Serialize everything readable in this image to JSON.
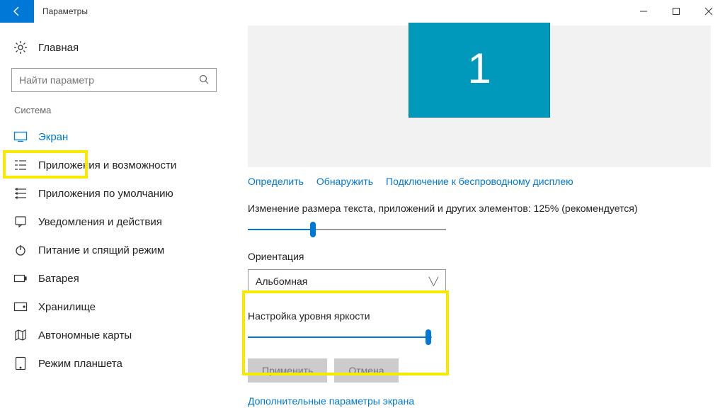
{
  "titlebar": {
    "title": "Параметры"
  },
  "sidebar": {
    "home": "Главная",
    "search_placeholder": "Найти параметр",
    "section": "Система",
    "items": [
      {
        "label": "Экран"
      },
      {
        "label": "Приложения и возможности"
      },
      {
        "label": "Приложения по умолчанию"
      },
      {
        "label": "Уведомления и действия"
      },
      {
        "label": "Питание и спящий режим"
      },
      {
        "label": "Батарея"
      },
      {
        "label": "Хранилище"
      },
      {
        "label": "Автономные карты"
      },
      {
        "label": "Режим планшета"
      }
    ]
  },
  "main": {
    "monitor_number": "1",
    "links": {
      "identify": "Определить",
      "detect": "Обнаружить",
      "wireless": "Подключение к беспроводному дисплею"
    },
    "scale_label": "Изменение размера текста, приложений и других элементов: 125% (рекомендуется)",
    "scale_slider_pct": 33,
    "orientation_label": "Ориентация",
    "orientation_value": "Альбомная",
    "brightness_label": "Настройка уровня яркости",
    "brightness_slider_pct": 98,
    "apply": "Применить",
    "cancel": "Отмена",
    "advanced": "Дополнительные параметры экрана"
  }
}
